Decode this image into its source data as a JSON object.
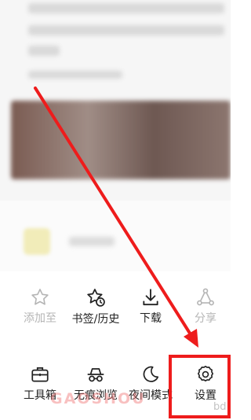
{
  "menu": {
    "row1": [
      {
        "label": "添加至",
        "icon": "star-icon",
        "enabled": false
      },
      {
        "label": "书签/历史",
        "icon": "bookmark-history-icon",
        "enabled": true
      },
      {
        "label": "下载",
        "icon": "download-icon",
        "enabled": true
      },
      {
        "label": "分享",
        "icon": "share-icon",
        "enabled": false
      }
    ],
    "row2": [
      {
        "label": "工具箱",
        "icon": "toolbox-icon",
        "enabled": true
      },
      {
        "label": "无痕浏览",
        "icon": "incognito-icon",
        "enabled": true
      },
      {
        "label": "夜间模式",
        "icon": "moon-icon",
        "enabled": true
      },
      {
        "label": "设置",
        "icon": "gear-icon",
        "enabled": true
      }
    ]
  },
  "annotation": {
    "color": "#ee1c1c",
    "target": "设置"
  },
  "watermark": {
    "text": "GAOSHOU",
    "suffix": "bd"
  }
}
